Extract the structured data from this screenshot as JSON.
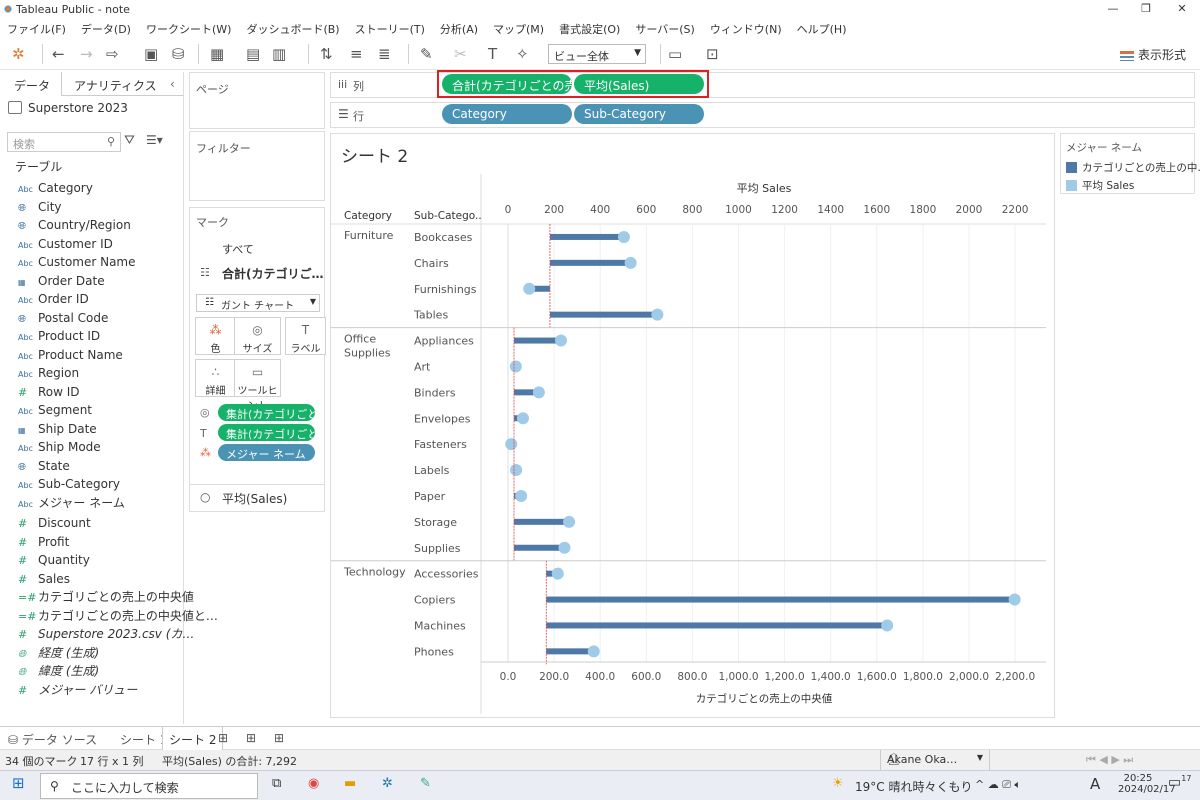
{
  "window": {
    "title": "Tableau Public - note"
  },
  "menu": [
    "ファイル(F)",
    "データ(D)",
    "ワークシート(W)",
    "ダッシュボード(B)",
    "ストーリー(T)",
    "分析(A)",
    "マップ(M)",
    "書式設定(O)",
    "サーバー(S)",
    "ウィンドウ(N)",
    "ヘルプ(H)"
  ],
  "toolbar": {
    "view_select": "ビュー全体",
    "show_me": "表示形式"
  },
  "left_pane": {
    "tab_data": "データ",
    "tab_analytics": "アナリティクス",
    "datasource": "Superstore 2023",
    "search_placeholder": "検索",
    "tables_header": "テーブル",
    "dimensions": [
      {
        "icon": "Abc",
        "name": "Category"
      },
      {
        "icon": "geo",
        "name": "City"
      },
      {
        "icon": "geo",
        "name": "Country/Region"
      },
      {
        "icon": "Abc",
        "name": "Customer ID"
      },
      {
        "icon": "Abc",
        "name": "Customer Name"
      },
      {
        "icon": "date",
        "name": "Order Date"
      },
      {
        "icon": "Abc",
        "name": "Order ID"
      },
      {
        "icon": "geo",
        "name": "Postal Code"
      },
      {
        "icon": "Abc",
        "name": "Product ID"
      },
      {
        "icon": "Abc",
        "name": "Product Name"
      },
      {
        "icon": "Abc",
        "name": "Region"
      },
      {
        "icon": "#",
        "name": "Row ID"
      },
      {
        "icon": "Abc",
        "name": "Segment"
      },
      {
        "icon": "date",
        "name": "Ship Date"
      },
      {
        "icon": "Abc",
        "name": "Ship Mode"
      },
      {
        "icon": "geo",
        "name": "State"
      },
      {
        "icon": "Abc",
        "name": "Sub-Category"
      },
      {
        "icon": "Abc",
        "name": "メジャー ネーム"
      }
    ],
    "measures": [
      {
        "icon": "#",
        "name": "Discount",
        "italic": false
      },
      {
        "icon": "#",
        "name": "Profit",
        "italic": false
      },
      {
        "icon": "#",
        "name": "Quantity",
        "italic": false
      },
      {
        "icon": "#",
        "name": "Sales",
        "italic": false
      },
      {
        "icon": "=#",
        "name": "カテゴリごとの売上の中央値",
        "italic": false
      },
      {
        "icon": "=#",
        "name": "カテゴリごとの売上の中央値と…",
        "italic": false
      },
      {
        "icon": "#",
        "name": "Superstore 2023.csv (カ…",
        "italic": true
      },
      {
        "icon": "geo",
        "name": "経度 (生成)",
        "italic": true
      },
      {
        "icon": "geo",
        "name": "緯度 (生成)",
        "italic": true
      },
      {
        "icon": "#",
        "name": "メジャー バリュー",
        "italic": true
      }
    ]
  },
  "shelves": {
    "pages_label": "ページ",
    "filters_label": "フィルター",
    "columns_label": "列",
    "rows_label": "行",
    "columns_pills": [
      "合計(カテゴリごとの売上..",
      "平均(Sales)"
    ],
    "rows_pills": [
      "Category",
      "Sub-Category"
    ]
  },
  "marks": {
    "label": "マーク",
    "all": "すべて",
    "section1": "合計(カテゴリご…",
    "mark_type": "ガント チャート",
    "buttons": [
      "色",
      "サイズ",
      "ラベル",
      "詳細",
      "ツールヒント"
    ],
    "pills": [
      "集計(カテゴリごと…",
      "集計(カテゴリごと…",
      "メジャー ネーム"
    ],
    "section2": "平均(Sales)"
  },
  "view": {
    "sheet_title": "シート 2"
  },
  "legend": {
    "title": "メジャー ネーム",
    "items": [
      {
        "label": "カテゴリごとの売上の中…",
        "color": "#4e79a7"
      },
      {
        "label": "平均 Sales",
        "color": "#a0cbe8"
      }
    ]
  },
  "chart_data": {
    "type": "bar",
    "title": "シート 2",
    "top_axis_label": "平均 Sales",
    "bottom_axis_label": "カテゴリごとの売上の中央値",
    "col_header_category": "Category",
    "col_header_subcategory": "Sub-Catego..",
    "top_ticks": [
      "0",
      "200",
      "400",
      "600",
      "800",
      "1000",
      "1200",
      "1400",
      "1600",
      "1800",
      "2000",
      "2200"
    ],
    "bottom_ticks": [
      "0.0",
      "200.0",
      "400.0",
      "600.0",
      "800.0",
      "1,000.0",
      "1,200.0",
      "1,400.0",
      "1,600.0",
      "1,800.0",
      "2,000.0",
      "2,200.0"
    ],
    "xlim": [
      -30,
      2290
    ],
    "categories": [
      {
        "name": "Furniture",
        "median": 182,
        "subs": [
          {
            "name": "Bookcases",
            "avg": 503
          },
          {
            "name": "Chairs",
            "avg": 532
          },
          {
            "name": "Furnishings",
            "avg": 92
          },
          {
            "name": "Tables",
            "avg": 648
          }
        ]
      },
      {
        "name": "Office\nSupplies",
        "median": 26,
        "subs": [
          {
            "name": "Appliances",
            "avg": 230
          },
          {
            "name": "Art",
            "avg": 34
          },
          {
            "name": "Binders",
            "avg": 134
          },
          {
            "name": "Envelopes",
            "avg": 65
          },
          {
            "name": "Fasteners",
            "avg": 14
          },
          {
            "name": "Labels",
            "avg": 35
          },
          {
            "name": "Paper",
            "avg": 57
          },
          {
            "name": "Storage",
            "avg": 265
          },
          {
            "name": "Supplies",
            "avg": 245
          }
        ]
      },
      {
        "name": "Technology",
        "median": 166,
        "subs": [
          {
            "name": "Accessories",
            "avg": 216
          },
          {
            "name": "Copiers",
            "avg": 2198
          },
          {
            "name": "Machines",
            "avg": 1645
          },
          {
            "name": "Phones",
            "avg": 372
          }
        ]
      }
    ]
  },
  "sheet_tabs": {
    "datasource": "データ ソース",
    "tabs": [
      "シート 1",
      "シート 2"
    ]
  },
  "status": {
    "marks": "34 個のマーク",
    "rows_cols": "17 行 x 1 列",
    "sum": "平均(Sales) の合計: 7,292",
    "user": "Akane Oka…"
  },
  "taskbar": {
    "search": "ここに入力して検索",
    "weather": "19°C  晴れ時々くもり",
    "time": "20:25",
    "date": "2024/02/17",
    "notif": "17"
  }
}
